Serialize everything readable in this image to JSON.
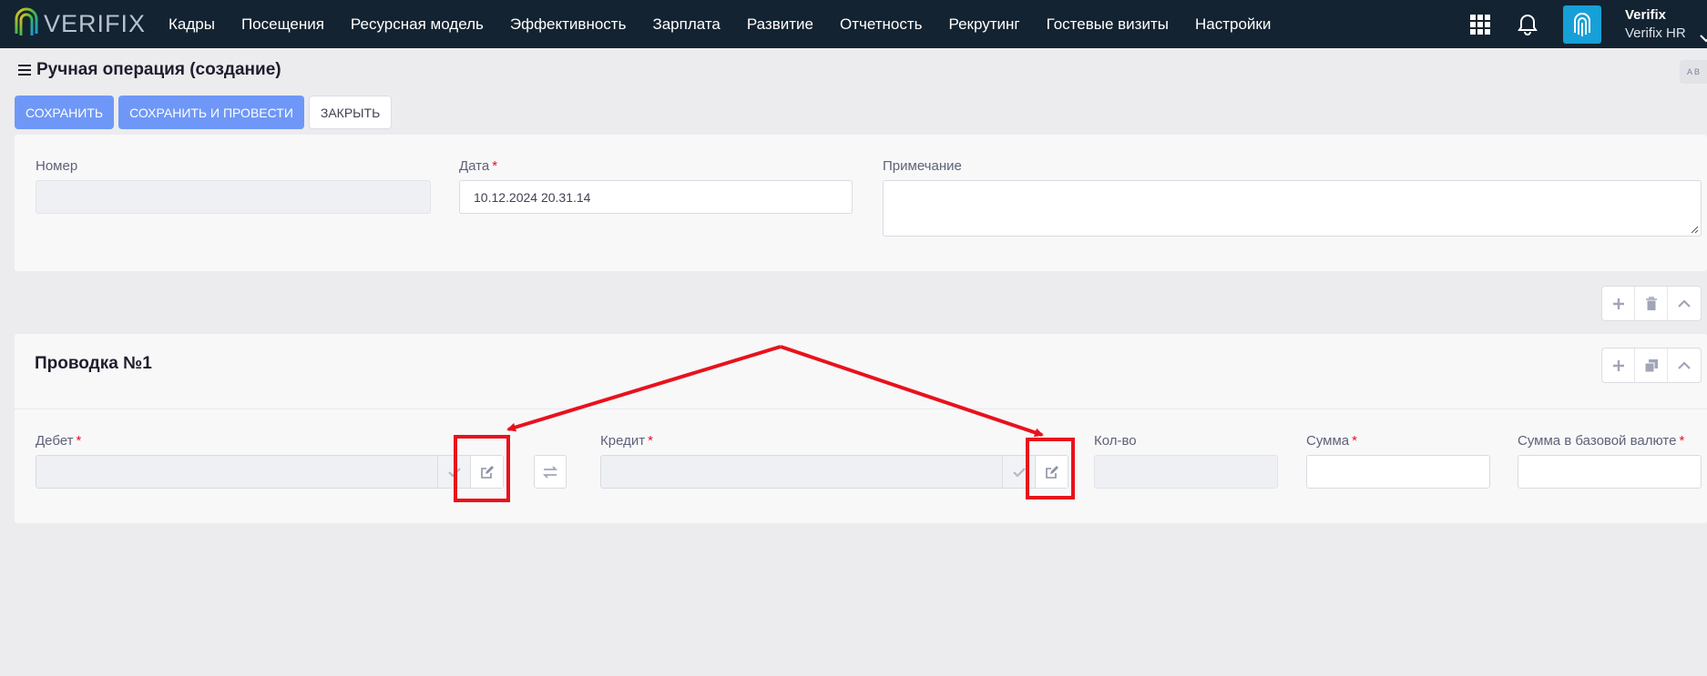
{
  "brand": {
    "logo_text": "VERIFIX",
    "accent": "#16a0d8",
    "nav_bg": "#132331"
  },
  "nav": {
    "items": [
      "Кадры",
      "Посещения",
      "Ресурсная модель",
      "Эффективность",
      "Зарплата",
      "Развитие",
      "Отчетность",
      "Рекрутинг",
      "Гостевые визиты",
      "Настройки"
    ]
  },
  "user": {
    "name": "Verifix",
    "org": "Verifix HR"
  },
  "icons": {
    "apps": "grid-icon",
    "notifications": "bell-icon",
    "avatar": "fingerprint-icon",
    "menu": "hamburger-icon"
  },
  "page": {
    "title": "Ручная операция (создание)"
  },
  "toolbar": {
    "save": "СОХРАНИТЬ",
    "save_post": "СОХРАНИТЬ И ПРОВЕСТИ",
    "close": "ЗАКРЫТЬ"
  },
  "header_form": {
    "number_label": "Номер",
    "number_value": "",
    "date_label": "Дата",
    "date_value": "10.12.2024 20.31.14",
    "note_label": "Примечание",
    "note_value": ""
  },
  "entry": {
    "title": "Проводка №1",
    "debit_label": "Дебет",
    "credit_label": "Кредит",
    "qty_label": "Кол-во",
    "sum_label": "Сумма",
    "base_sum_label": "Сумма в базовой валюте"
  },
  "required_mark": "*",
  "annotation_color": "#e8121c"
}
